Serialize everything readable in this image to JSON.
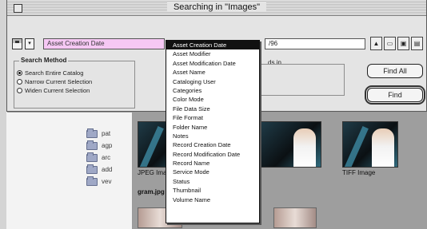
{
  "dialog": {
    "title": "Searching in \"Images\"",
    "search": {
      "criteria_field": "Asset Creation Date",
      "criteria_popup_glyph": "▾",
      "value_field": "",
      "value_suffix": "/96"
    },
    "toolbar_glyphs": [
      "▲",
      "▭",
      "▣",
      "▤"
    ],
    "search_method": {
      "label": "Search Method",
      "options": [
        {
          "label": "Search Entire Catalog",
          "selected": true
        },
        {
          "label": "Narrow Current Selection",
          "selected": false
        },
        {
          "label": "Widen Current Selection",
          "selected": false
        }
      ]
    },
    "group2": {
      "prefix": "ds in...",
      "label": ""
    },
    "buttons": {
      "find_all": "Find All",
      "find": "Find"
    }
  },
  "menu": {
    "selected_index": 0,
    "items": [
      "Asset Creation Date",
      "Asset Modifier",
      "Asset Modification Date",
      "Asset Name",
      "Cataloging User",
      "Categories",
      "Color Mode",
      "File Data Size",
      "File Format",
      "Folder Name",
      "Notes",
      "Record Creation Date",
      "Record Modification Date",
      "Record Name",
      "Service Mode",
      "Status",
      "Thumbnail",
      "Volume Name"
    ]
  },
  "background": {
    "folders": [
      "pat",
      "agp",
      "arc",
      "add",
      "vev"
    ],
    "thumbnails": [
      {
        "caption": "JPEG Image",
        "caption2": "gram.jpg"
      },
      {
        "caption": "",
        "caption2": ""
      },
      {
        "caption": "TIFF Image",
        "caption2": ""
      }
    ]
  }
}
